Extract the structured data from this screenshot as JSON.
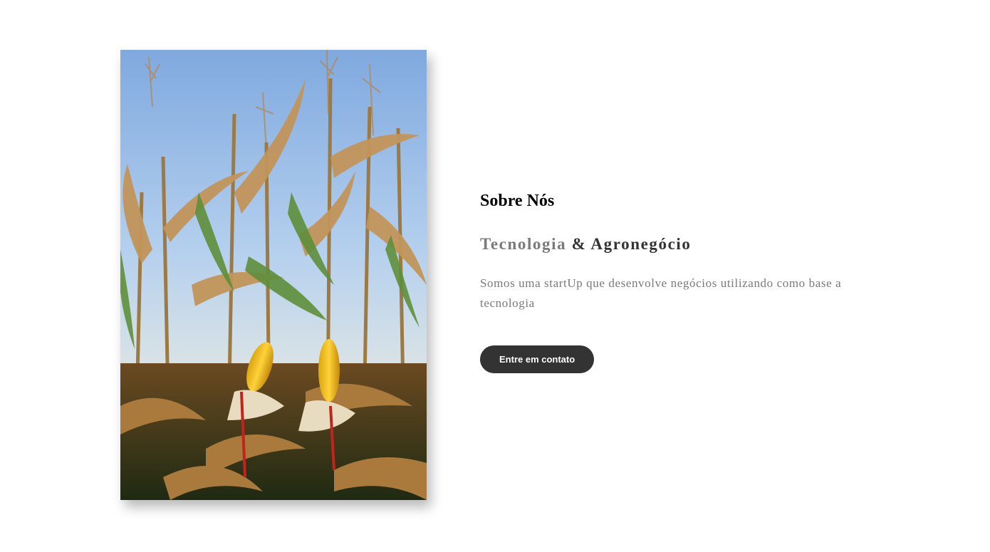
{
  "about": {
    "image_alt": "corn-field-photo",
    "title": "Sobre Nós",
    "subtitle_highlight": "Tecnologia",
    "subtitle_rest": " & Agronegócio",
    "description": "Somos uma startUp que desenvolve negócios utilizando como base a tecnologia",
    "cta_label": "Entre em contato"
  },
  "colors": {
    "button_bg": "#333333",
    "text_muted": "#7a7a7a",
    "text_dark": "#333333",
    "sky": "#8fb8e6"
  }
}
